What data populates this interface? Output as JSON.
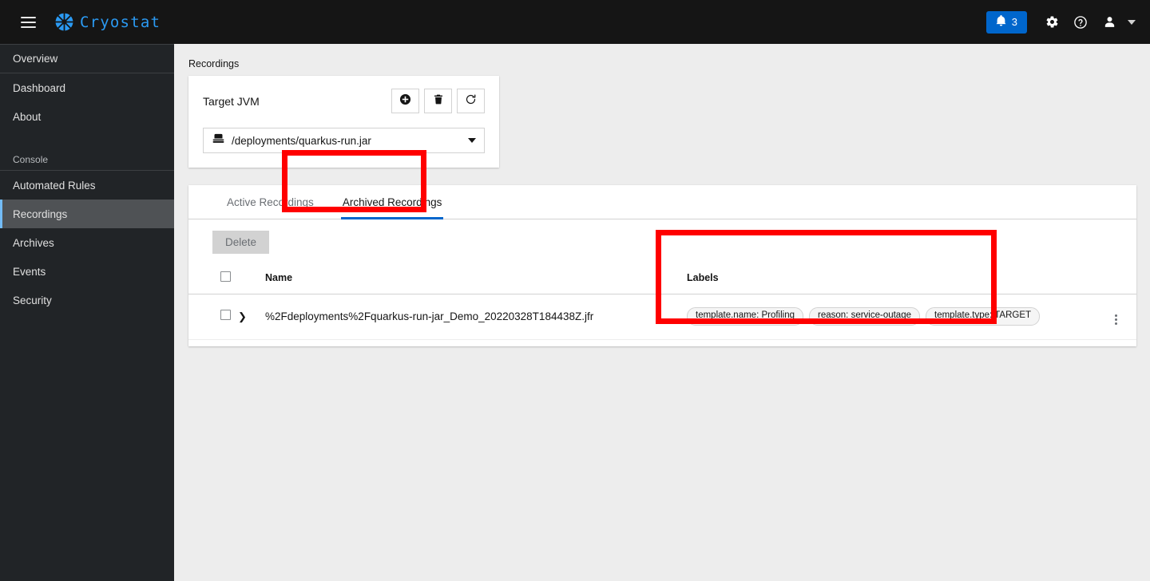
{
  "masthead": {
    "hamburger_icon": "hamburger-menu-icon",
    "brand_name": "Cryostat",
    "brand_logo_icon": "cryostat-logo-icon",
    "notification_count": "3",
    "notification_icon": "bell-icon",
    "settings_icon": "gear-icon",
    "help_icon": "question-circle-icon",
    "user_icon": "user-avatar-icon",
    "user_caret_icon": "chevron-down-icon",
    "accent_color": "#0066cc",
    "brand_color": "#2b9af3",
    "background_color": "#151515"
  },
  "sidebar": {
    "background_color": "#212427",
    "active_color": "#4f5255",
    "active_marker_color": "#73bcf7",
    "items": [
      {
        "label": "Overview",
        "active": false
      },
      {
        "label": "Dashboard",
        "active": false
      },
      {
        "label": "About",
        "active": false
      }
    ],
    "section_label": "Console",
    "console_items": [
      {
        "label": "Automated Rules",
        "active": false
      },
      {
        "label": "Recordings",
        "active": true
      },
      {
        "label": "Archives",
        "active": false
      },
      {
        "label": "Events",
        "active": false
      },
      {
        "label": "Security",
        "active": false
      }
    ]
  },
  "main": {
    "breadcrumb": "Recordings",
    "target_card": {
      "title": "Target JVM",
      "buttons": [
        {
          "name": "create-target-button",
          "icon": "plus-circle-icon"
        },
        {
          "name": "delete-target-button",
          "icon": "trash-icon"
        },
        {
          "name": "refresh-targets-button",
          "icon": "refresh-icon"
        }
      ],
      "select": {
        "icon": "server-icon",
        "value": "/deployments/quarkus-run.jar",
        "caret_icon": "caret-down-icon"
      }
    },
    "tabs": [
      {
        "label": "Active Recordings",
        "active": false
      },
      {
        "label": "Archived Recordings",
        "active": true
      }
    ],
    "toolbar": {
      "delete_label": "Delete",
      "delete_disabled": true
    },
    "table": {
      "columns": [
        "Name",
        "Labels"
      ],
      "select_all_icon": "checkbox-icon",
      "rows": [
        {
          "checkbox_icon": "checkbox-icon",
          "expand_icon": "chevron-right-icon",
          "name": "%2Fdeployments%2Fquarkus-run-jar_Demo_20220328T184438Z.jfr",
          "labels": [
            "template.name: Profiling",
            "reason: service-outage",
            "template.type: TARGET"
          ],
          "kebab_icon": "kebab-menu-icon"
        }
      ]
    }
  },
  "annotations": {
    "color": "#ff0000",
    "boxes": [
      {
        "name": "archived-recordings-tab-highlight"
      },
      {
        "name": "labels-column-highlight"
      }
    ]
  }
}
